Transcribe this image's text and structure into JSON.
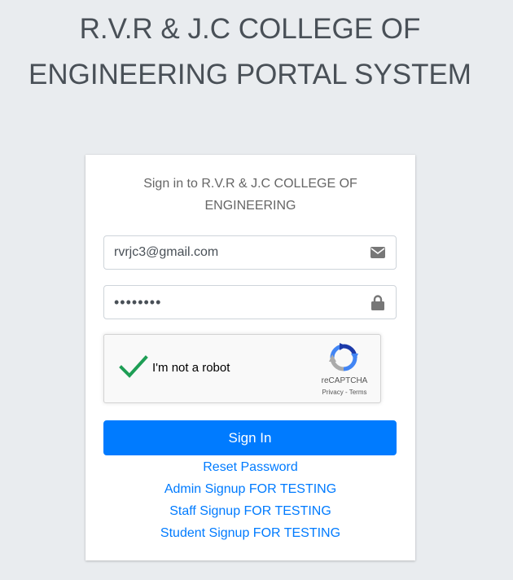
{
  "header": {
    "title_bold": "R.V.R & J.C COLLEGE OF ENGINEERING",
    "title_light": "PORTAL SYSTEM"
  },
  "login": {
    "message": "Sign in to R.V.R & J.C COLLEGE OF ENGINEERING",
    "email_value": "rvrjc3@gmail.com",
    "password_value": "••••••••",
    "email_icon": "envelope-icon",
    "password_icon": "lock-icon",
    "recaptcha": {
      "label": "I'm not a robot",
      "brand": "reCAPTCHA",
      "privacy": "Privacy",
      "separator": " - ",
      "terms": "Terms",
      "checked": true
    },
    "signin_label": "Sign In",
    "links": [
      "Reset Password",
      "Admin Signup FOR TESTING",
      "Staff Signup FOR TESTING",
      "Student Signup FOR TESTING"
    ]
  },
  "colors": {
    "background": "#e9ecef",
    "primary": "#007bff",
    "check": "#1e9e55"
  }
}
